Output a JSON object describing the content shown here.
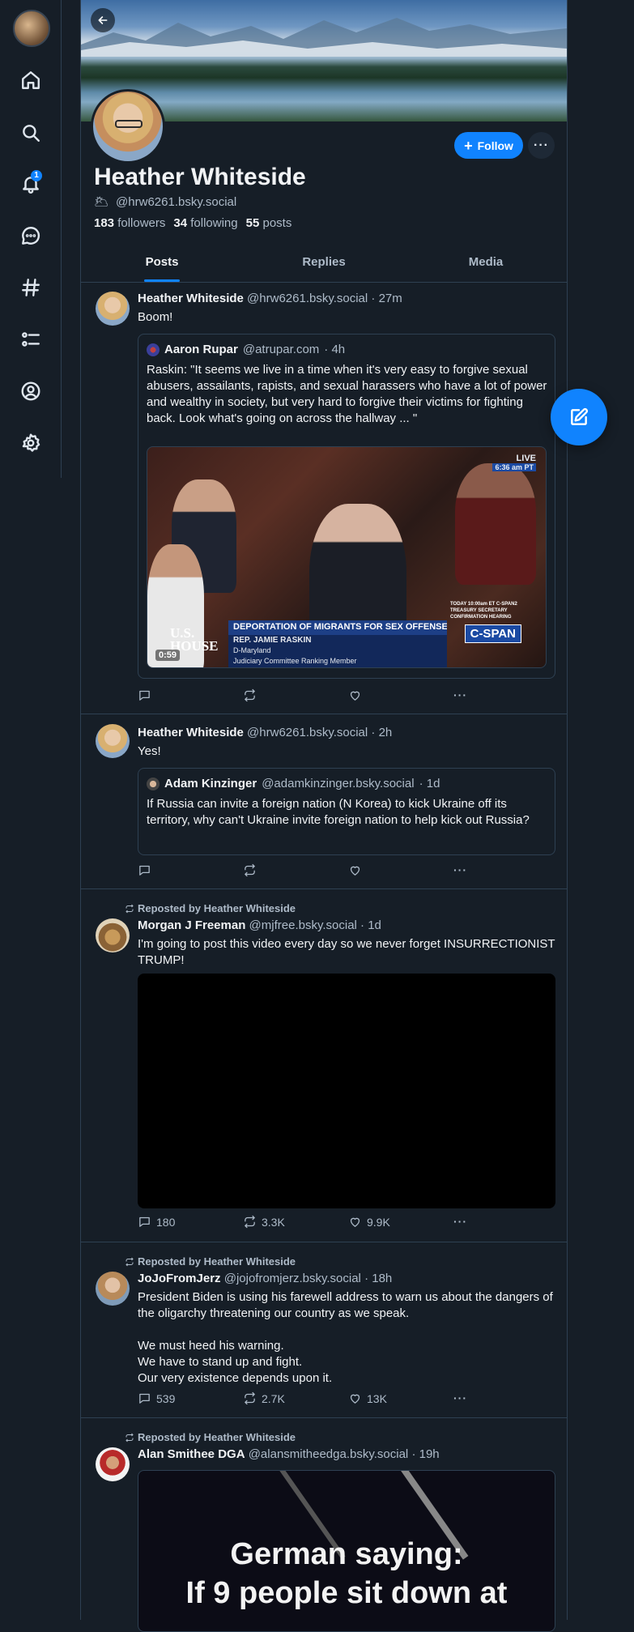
{
  "profile": {
    "display_name": "Heather Whiteside",
    "handle": "@hrw6261.bsky.social",
    "followers_count": "183",
    "followers_label": "followers",
    "following_count": "34",
    "following_label": "following",
    "posts_count": "55",
    "posts_label": "posts",
    "follow_label": "Follow"
  },
  "nav": {
    "notification_count": "1",
    "icons": [
      "home-icon",
      "search-icon",
      "bell-icon",
      "chat-icon",
      "hashtag-icon",
      "list-icon",
      "profile-icon",
      "gear-icon"
    ]
  },
  "tabs": [
    "Posts",
    "Replies",
    "Media"
  ],
  "posts": [
    {
      "author": "Heather Whiteside",
      "handle": "@hrw6261.bsky.social",
      "time": "· 27m",
      "text": "Boom!",
      "quote": {
        "author": "Aaron Rupar",
        "handle": "@atrupar.com",
        "time": "· 4h",
        "text": "Raskin: \"It seems we live in a time when it's very easy to forgive sexual abusers, assailants, rapists, and sexual harassers who have a lot of power and wealthy in society, but very hard to forgive their victims for fighting back. Look what's going on across the hallway ... \"",
        "video": {
          "live": "LIVE",
          "live_time": "6:36 am PT",
          "chyron_title": "DEPORTATION OF MIGRANTS FOR SEX OFFENSES",
          "chyron_name": "REP. JAMIE RASKIN",
          "chyron_line2": "D-Maryland",
          "chyron_line3": "Judiciary Committee Ranking Member",
          "house_line1": "U.S.",
          "house_line2": "HOUSE",
          "network": "C-SPAN",
          "side_note_1": "TODAY 10:00am ET C-SPAN2",
          "side_note_2": "TREASURY SECRETARY",
          "side_note_3": "CONFIRMATION HEARING",
          "duration": "0:59"
        }
      },
      "replies": "",
      "reposts": "",
      "likes": ""
    },
    {
      "author": "Heather Whiteside",
      "handle": "@hrw6261.bsky.social",
      "time": "· 2h",
      "text": "Yes!",
      "quote": {
        "author": "Adam Kinzinger",
        "handle": "@adamkinzinger.bsky.social",
        "time": "· 1d",
        "text": "If Russia can invite a foreign nation (N Korea) to kick Ukraine off its territory, why can't Ukraine invite foreign nation to help kick out Russia?"
      },
      "replies": "",
      "reposts": "",
      "likes": ""
    },
    {
      "repost_label": "Reposted by Heather Whiteside",
      "author": "Morgan J Freeman",
      "handle": "@mjfree.bsky.social",
      "time": "· 1d",
      "text": "I'm going to post this video every day so we never forget INSURRECTIONIST TRUMP!",
      "replies": "180",
      "reposts": "3.3K",
      "likes": "9.9K"
    },
    {
      "repost_label": "Reposted by Heather Whiteside",
      "author": "JoJoFromJerz",
      "handle": "@jojofromjerz.bsky.social",
      "time": "· 18h",
      "text_lines": [
        "President Biden is using his farewell address to warn us about the dangers of the oligarchy threatening our country as we speak.",
        "",
        "We must heed his warning.",
        "We have to stand up and fight.",
        "Our very existence depends upon it."
      ],
      "replies": "539",
      "reposts": "2.7K",
      "likes": "13K"
    },
    {
      "repost_label": "Reposted by Heather Whiteside",
      "author": "Alan Smithee DGA",
      "handle": "@alansmitheedga.bsky.social",
      "time": "· 19h",
      "image_line1": "German saying:",
      "image_line2": "If 9 people sit down at"
    }
  ],
  "colors": {
    "background": "#161e27",
    "accent": "#1083fe",
    "border": "#2e4052",
    "muted_text": "#aebbc9"
  }
}
